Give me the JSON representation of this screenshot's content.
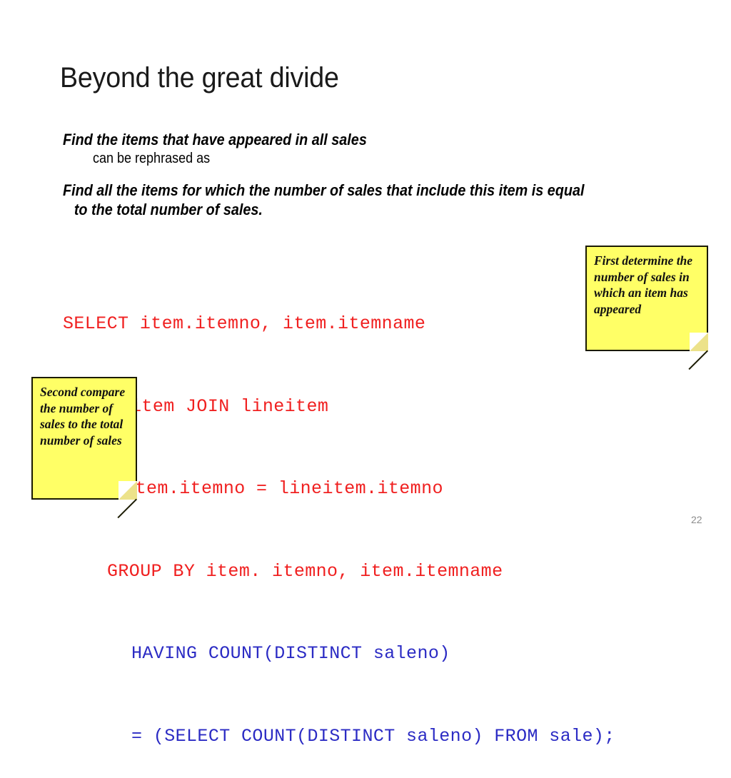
{
  "slide": {
    "title": "Beyond the great divide",
    "page_number": "22"
  },
  "body": {
    "statement_original": "Find the items that have appeared in all sales",
    "connector": "can be rephrased as",
    "statement_rephrased_line1": "Find all the items for which the number of sales that include this item is equal",
    "statement_rephrased_line2": "to the total number of sales."
  },
  "sql": {
    "lines": [
      {
        "text": "SELECT item.itemno, item.itemname",
        "color": "red",
        "indent": 0
      },
      {
        "text": "FROM item JOIN lineitem",
        "color": "red",
        "indent": 1
      },
      {
        "text": "ON item.itemno = lineitem.itemno",
        "color": "red",
        "indent": 2
      },
      {
        "text": "GROUP BY item. itemno, item.itemname",
        "color": "red",
        "indent": 3
      },
      {
        "text": "HAVING COUNT(DISTINCT saleno)",
        "color": "blue",
        "indent": 4
      },
      {
        "text": "= (SELECT COUNT(DISTINCT saleno) FROM sale);",
        "color": "blue",
        "indent": 5
      }
    ],
    "color_red": "#f02020",
    "color_blue": "#2b2bc4"
  },
  "notes": {
    "first": {
      "text": "First determine the number of sales in which an  item has appeared"
    },
    "second": {
      "text": "Second compare the number of sales to the total number of sales"
    },
    "paper_color": "#ffff66"
  }
}
